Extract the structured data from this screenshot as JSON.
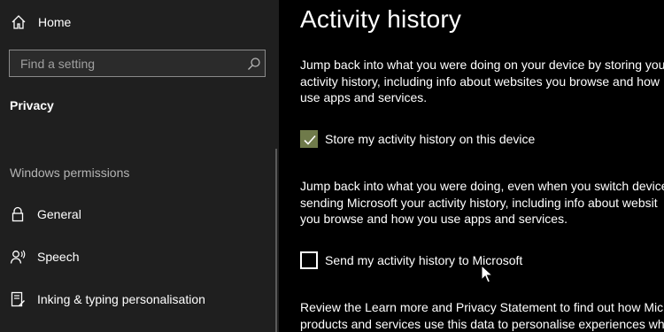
{
  "sidebar": {
    "home_label": "Home",
    "search_placeholder": "Find a setting",
    "section_title": "Privacy",
    "group_title": "Windows permissions",
    "items": [
      {
        "label": "General",
        "icon": "lock-icon"
      },
      {
        "label": "Speech",
        "icon": "speech-icon"
      },
      {
        "label": "Inking & typing personalisation",
        "icon": "inking-icon"
      }
    ]
  },
  "main": {
    "title": "Activity history",
    "para1": [
      "Jump back into what you were doing on your device by storing your",
      "activity history, including info about websites you browse and how",
      "use apps and services."
    ],
    "checkbox1": {
      "label": "Store my activity history on this device",
      "checked": true
    },
    "para2": [
      "Jump back into what you were doing, even when you switch devices",
      "sending Microsoft your activity history, including info about websit",
      "you browse and how you use apps and services."
    ],
    "checkbox2": {
      "label": "Send my activity history to Microsoft",
      "checked": false
    },
    "para3": [
      "Review the Learn more and Privacy Statement to find out how Micr",
      "products and services use this data to personalise experiences whil"
    ]
  },
  "colors": {
    "sidebar_bg": "#1f1f1f",
    "main_bg": "#000000",
    "accent_checked": "#6f7a4a"
  }
}
